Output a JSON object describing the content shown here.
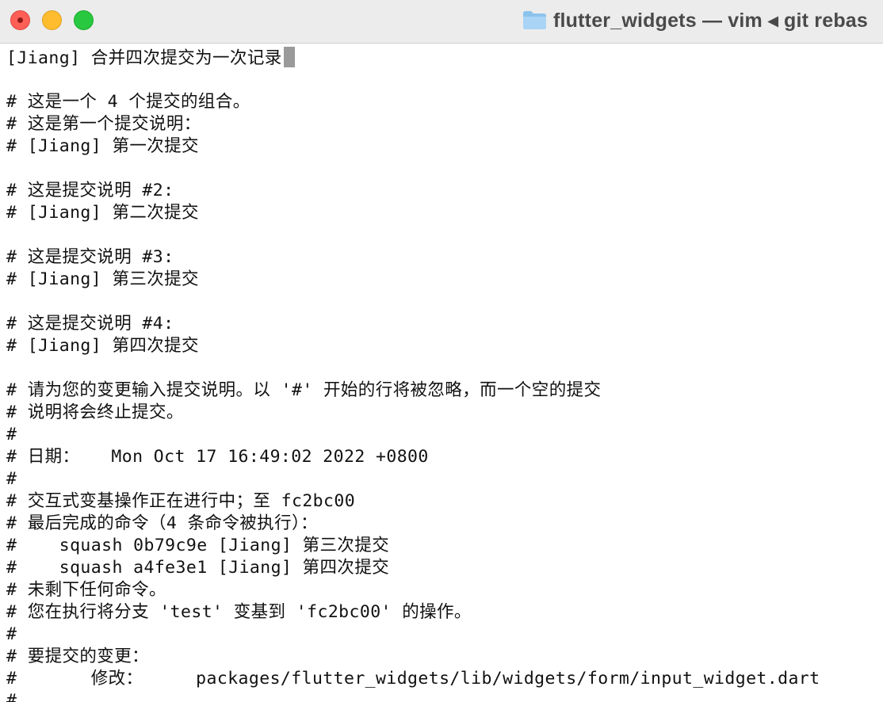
{
  "window": {
    "title": "flutter_widgets — vim ◂ git rebas",
    "folder_icon": "folder-icon",
    "buttons": {
      "close_color": "#fe5f57",
      "minimize_color": "#febc2e",
      "zoom_color": "#28c840"
    }
  },
  "editor": {
    "lines": [
      "[Jiang] 合并四次提交为一次记录",
      "",
      "# 这是一个 4 个提交的组合。",
      "# 这是第一个提交说明：",
      "# [Jiang] 第一次提交",
      "",
      "# 这是提交说明 #2:",
      "# [Jiang] 第二次提交",
      "",
      "# 这是提交说明 #3:",
      "# [Jiang] 第三次提交",
      "",
      "# 这是提交说明 #4:",
      "# [Jiang] 第四次提交",
      "",
      "# 请为您的变更输入提交说明。以 '#' 开始的行将被忽略，而一个空的提交",
      "# 说明将会终止提交。",
      "#",
      "# 日期：   Mon Oct 17 16:49:02 2022 +0800",
      "#",
      "# 交互式变基操作正在进行中；至 fc2bc00",
      "# 最后完成的命令（4 条命令被执行）：",
      "#    squash 0b79c9e [Jiang] 第三次提交",
      "#    squash a4fe3e1 [Jiang] 第四次提交",
      "# 未剩下任何命令。",
      "# 您在执行将分支 'test' 变基到 'fc2bc00' 的操作。",
      "#",
      "# 要提交的变更：",
      "#       修改：     packages/flutter_widgets/lib/widgets/form/input_widget.dart",
      "#"
    ]
  }
}
